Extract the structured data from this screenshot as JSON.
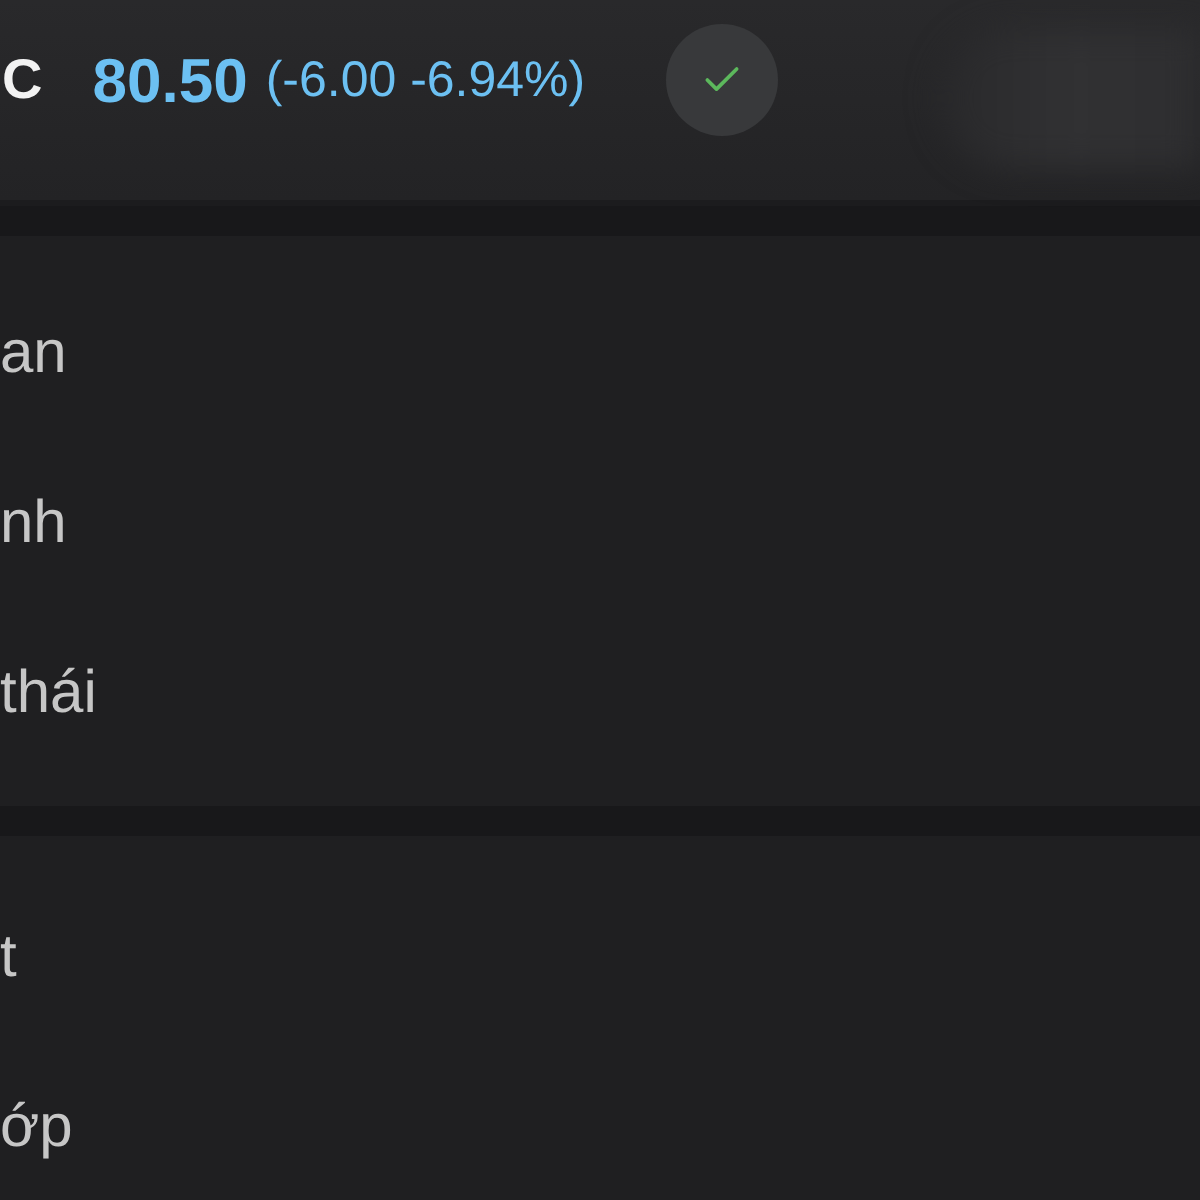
{
  "header": {
    "symbol": "C",
    "price": "80.50",
    "change": "(-6.00 -6.94%)"
  },
  "sections": [
    {
      "items": [
        {
          "label": "an"
        },
        {
          "label": "nh"
        },
        {
          "label": "thái"
        }
      ]
    },
    {
      "items": [
        {
          "label": "t"
        },
        {
          "label": "ớp"
        }
      ]
    }
  ]
}
